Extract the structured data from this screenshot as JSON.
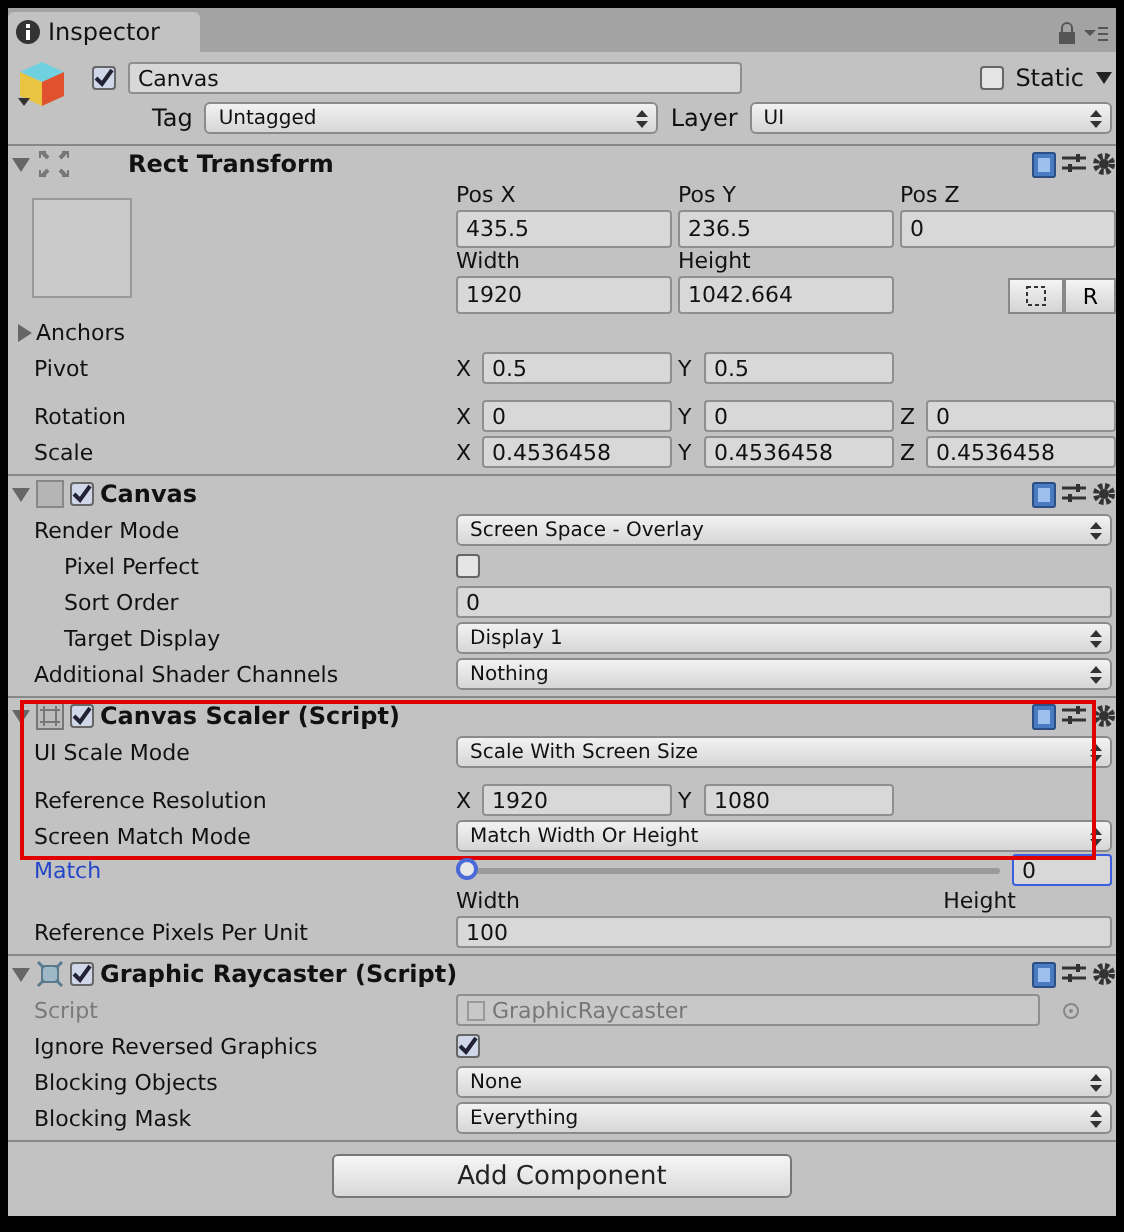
{
  "tab": {
    "title": "Inspector"
  },
  "object": {
    "active": true,
    "name": "Canvas",
    "static_label": "Static",
    "static": false,
    "tag_label": "Tag",
    "tag": "Untagged",
    "layer_label": "Layer",
    "layer": "UI"
  },
  "components": [
    {
      "title": "Rect Transform",
      "kind": "rect_transform",
      "expanded": true,
      "highlighted": false,
      "rows": [
        {
          "kind": "grid",
          "lines": [
            {
              "fields": [
                {
                  "label": "Pos X",
                  "value": "435.5"
                },
                {
                  "label": "Pos Y",
                  "value": "236.5"
                },
                {
                  "label": "Pos Z",
                  "value": "0"
                }
              ]
            },
            {
              "fields": [
                {
                  "label": "Width",
                  "value": "1920"
                },
                {
                  "label": "Height",
                  "value": "1042.664"
                }
              ],
              "button": "R"
            }
          ]
        },
        {
          "kind": "foldout",
          "label": "Anchors",
          "expanded": false
        },
        {
          "kind": "vector",
          "label": "Pivot",
          "fields": [
            {
              "axis": "X",
              "value": "0.5"
            },
            {
              "axis": "Y",
              "value": "0.5"
            }
          ]
        },
        {
          "kind": "vector",
          "label": "Rotation",
          "spaced": true,
          "fields": [
            {
              "axis": "X",
              "value": "0"
            },
            {
              "axis": "Y",
              "value": "0"
            },
            {
              "axis": "Z",
              "value": "0"
            }
          ]
        },
        {
          "kind": "vector",
          "label": "Scale",
          "fields": [
            {
              "axis": "X",
              "value": "0.4536458"
            },
            {
              "axis": "Y",
              "value": "0.4536458"
            },
            {
              "axis": "Z",
              "value": "0.4536458"
            }
          ]
        }
      ]
    },
    {
      "title": "Canvas",
      "kind": "canvas",
      "enabled": true,
      "expanded": true,
      "highlighted": false,
      "rows": [
        {
          "kind": "dropdown",
          "label": "Render Mode",
          "value": "Screen Space - Overlay"
        },
        {
          "kind": "checkbox",
          "label": "Pixel Perfect",
          "checked": false,
          "indented": true
        },
        {
          "kind": "text",
          "label": "Sort Order",
          "value": "0",
          "indented": true
        },
        {
          "kind": "dropdown",
          "label": "Target Display",
          "value": "Display 1",
          "indented": true
        },
        {
          "kind": "dropdown",
          "label": "Additional Shader Channels",
          "value": "Nothing"
        }
      ]
    },
    {
      "title": "Canvas Scaler (Script)",
      "kind": "scaler",
      "enabled": true,
      "expanded": true,
      "highlighted": true,
      "rows": [
        {
          "kind": "dropdown",
          "label": "UI Scale Mode",
          "value": "Scale With Screen Size"
        },
        {
          "kind": "vector",
          "label": "Reference Resolution",
          "spaced": true,
          "fields": [
            {
              "axis": "X",
              "value": "1920"
            },
            {
              "axis": "Y",
              "value": "1080"
            }
          ]
        },
        {
          "kind": "dropdown",
          "label": "Screen Match Mode",
          "value": "Match Width Or Height"
        },
        {
          "kind": "slider",
          "label": "Match",
          "focused": true,
          "level": 0,
          "value": "0",
          "min_label": "Width",
          "max_label": "Height"
        },
        {
          "kind": "text",
          "label": "Reference Pixels Per Unit",
          "value": "100"
        }
      ]
    },
    {
      "title": "Graphic Raycaster (Script)",
      "kind": "raycaster",
      "enabled": true,
      "expanded": true,
      "highlighted": false,
      "rows": [
        {
          "kind": "object",
          "label": "Script",
          "value": "GraphicRaycaster",
          "disabled": true
        },
        {
          "kind": "checkbox",
          "label": "Ignore Reversed Graphics",
          "checked": true
        },
        {
          "kind": "dropdown",
          "label": "Blocking Objects",
          "value": "None"
        },
        {
          "kind": "dropdown",
          "label": "Blocking Mask",
          "value": "Everything"
        }
      ]
    }
  ],
  "add_button": "Add Component"
}
